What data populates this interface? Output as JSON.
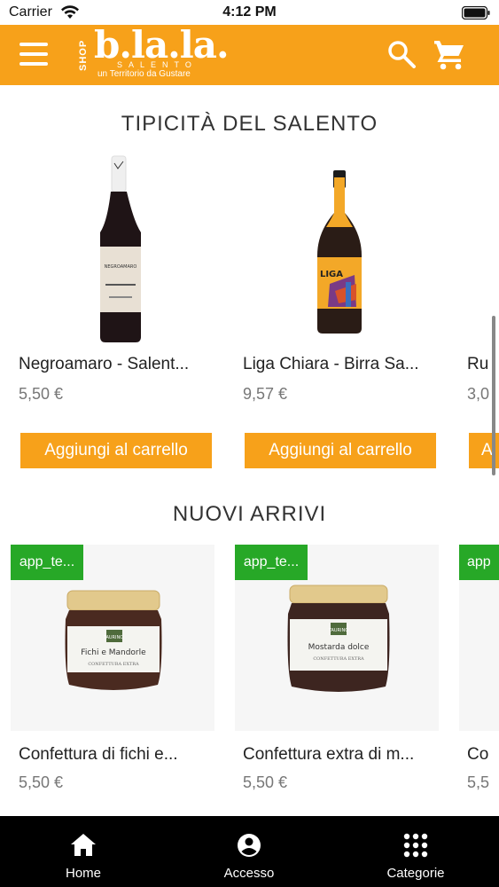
{
  "status_bar": {
    "carrier": "Carrier",
    "time": "4:12 PM"
  },
  "header": {
    "logo_shop": "SHOP",
    "logo_main": "b.la.la.",
    "logo_sub": "SALENTO",
    "logo_tagline": "un Territorio da Gustare",
    "icons": [
      "menu-icon",
      "search-icon",
      "cart-icon"
    ]
  },
  "sections": {
    "tipicita": {
      "title": "TIPICITÀ DEL SALENTO",
      "products": [
        {
          "name": "Negroamaro - Salento IGP",
          "display_name": "Negroamaro - Salent...",
          "price": "5,50 €",
          "button": "Aggiungi al carrello"
        },
        {
          "name": "Liga Chiara - Birra Salento",
          "display_name": "Liga Chiara - Birra Sa...",
          "price": "9,57 €",
          "button": "Aggiungi al carrello"
        },
        {
          "display_name": "Ru",
          "price": "3,0",
          "button": "A"
        }
      ]
    },
    "nuovi": {
      "title": "NUOVI ARRIVI",
      "products": [
        {
          "badge": "app_te...",
          "display_name": "Confettura di fichi e...",
          "price": "5,50 €",
          "label_title": "Fichi e Mandorle",
          "label_brand": "TAURINO",
          "label_sub": "CONFETTURA EXTRA"
        },
        {
          "badge": "app_te...",
          "display_name": "Confettura extra di m...",
          "price": "5,50 €",
          "label_title": "Mostarda dolce",
          "label_brand": "TAURINO",
          "label_sub": "CONFETTURA EXTRA"
        },
        {
          "badge": "app",
          "display_name": "Co",
          "price": "5,5"
        }
      ]
    }
  },
  "wine_label": "NEGROAMARO",
  "beer_label": "LIGA",
  "tab_bar": {
    "tabs": [
      {
        "label": "Home",
        "icon": "home-icon"
      },
      {
        "label": "Accesso",
        "icon": "account-icon"
      },
      {
        "label": "Categorie",
        "icon": "grid-icon"
      }
    ]
  },
  "colors": {
    "accent": "#f7a11a",
    "badge": "#27a827",
    "tab_bar": "#000000"
  }
}
